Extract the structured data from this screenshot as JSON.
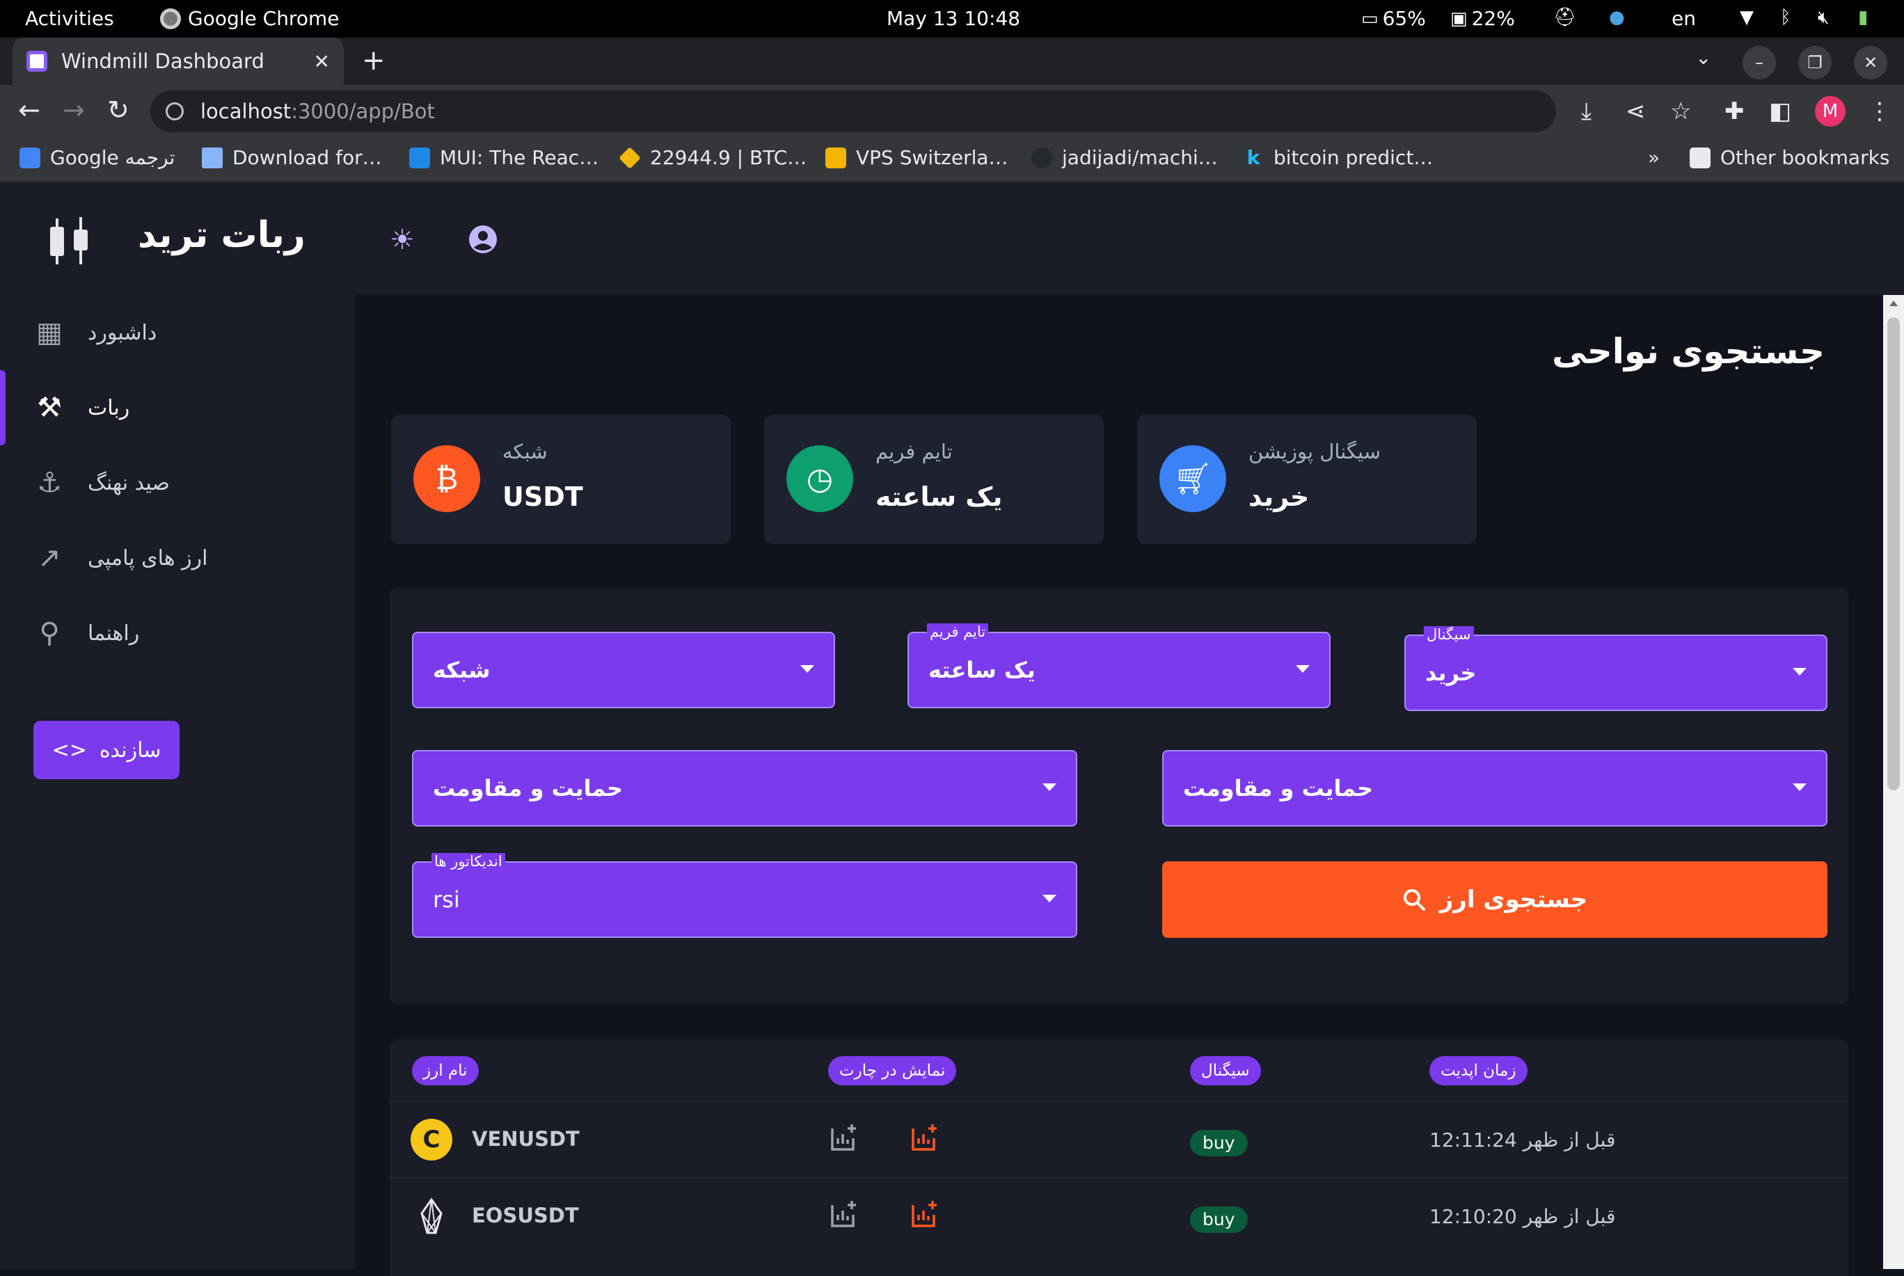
{
  "os": {
    "activities": "Activities",
    "app_name": "Google Chrome",
    "datetime": "May 13  10:48",
    "battery1": "65%",
    "battery2": "22%",
    "language": "en"
  },
  "browser": {
    "tab_title": "Windmill Dashboard",
    "url_host": "localhost",
    "url_path": ":3000/app/Bot",
    "profile_initial": "M",
    "bookmarks": [
      "Google ترجمه",
      "Download for…",
      "MUI: The Reac…",
      "22944.9 | BTC…",
      "VPS Switzerla…",
      "jadijadi/machi…",
      "bitcoin predict…"
    ],
    "more_bookmarks": "»",
    "other_bookmarks": "Other bookmarks"
  },
  "header": {
    "brand": "ربات ترید"
  },
  "sidebar": {
    "items": [
      {
        "label": "داشبورد",
        "icon": "dashboard-icon"
      },
      {
        "label": "ربات",
        "icon": "robot-icon"
      },
      {
        "label": "صید نهنگ",
        "icon": "hook-icon"
      },
      {
        "label": "ارز های پامپی",
        "icon": "trending-up-icon"
      },
      {
        "label": "راهنما",
        "icon": "location-pin-icon"
      }
    ],
    "builder_label": "سازنده",
    "builder_icon": "<>"
  },
  "page": {
    "title": "جستجوی نواحی"
  },
  "stats": [
    {
      "label": "سیگنال پوزیشن",
      "value": "خرید",
      "color": "#3b82f6"
    },
    {
      "label": "تایم فریم",
      "value": "یک ساعته",
      "color": "#0e9f6e"
    },
    {
      "label": "شبکه",
      "value": "USDT",
      "color": "#ff5722"
    }
  ],
  "filters": {
    "signal_label": "سیگنال",
    "signal_value": "خرید",
    "timeframe_label": "تایم فریم",
    "timeframe_value": "یک ساعته",
    "network_value": "شبکه",
    "support_resistance_1": "حمایت و مقاومت",
    "support_resistance_2": "حمایت و مقاومت",
    "indicators_label": "اندیکاتور ها",
    "indicators_value": "rsi",
    "search_button": "جستجوی ارز"
  },
  "table": {
    "headers": {
      "coin_name": "نام ارز",
      "show_chart": "نمایش در چارت",
      "signal": "سیگنال",
      "update_time": "زمان اپدیت"
    },
    "rows": [
      {
        "name": "VENUSDT",
        "signal": "buy",
        "time": "قبل از ظهر 12:11:24"
      },
      {
        "name": "EOSUSDT",
        "signal": "buy",
        "time": "قبل از ظهر 12:10:20"
      }
    ]
  },
  "colors": {
    "accent": "#7c3aed",
    "orange": "#ff5722",
    "buy_badge": "#0b5c3b"
  }
}
